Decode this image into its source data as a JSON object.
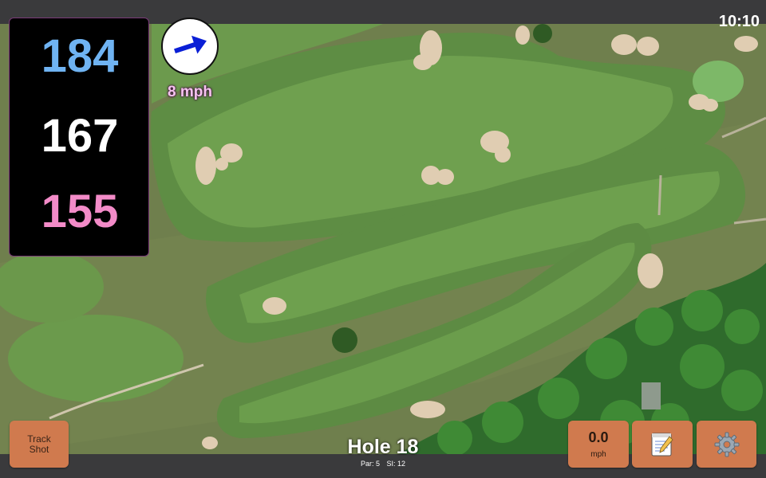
{
  "status_bar": {
    "time": "10:10"
  },
  "distances": {
    "back": "184",
    "middle": "167",
    "front": "155"
  },
  "wind": {
    "speed_label": "8 mph",
    "direction_icon": "arrow-icon"
  },
  "hole": {
    "title": "Hole 18",
    "par_label": "Par: 5",
    "si_label": "SI: 12"
  },
  "buttons": {
    "track_shot": "Track Shot",
    "speed_value": "0.0",
    "speed_unit": "mph",
    "notes_icon": "notepad-icon",
    "settings_icon": "gear-icon"
  },
  "colors": {
    "back": "#6fb3f2",
    "middle": "#ffffff",
    "front": "#f38bc8",
    "button": "#d07a4e",
    "wind_text": "#f6c3ef"
  }
}
